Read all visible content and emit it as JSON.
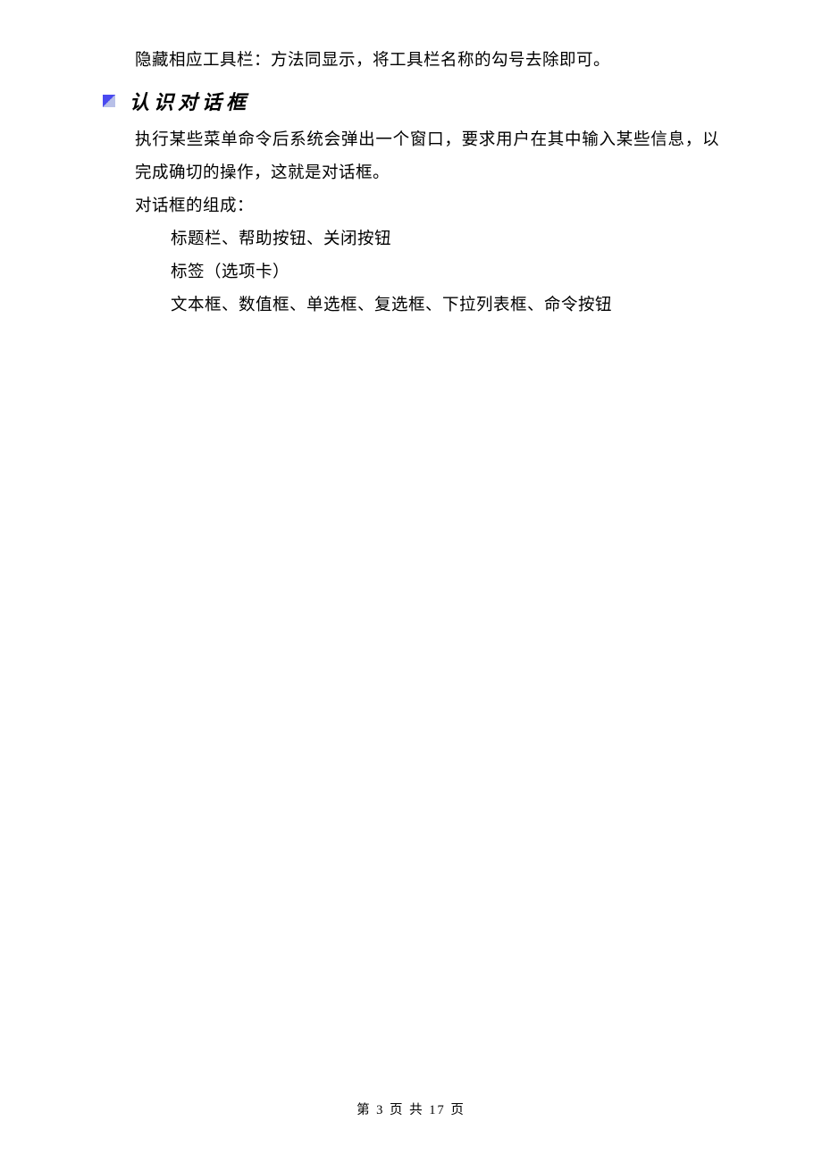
{
  "paragraphs": {
    "intro": "隐藏相应工具栏：方法同显示，将工具栏名称的勾号去除即可。",
    "heading": "认识对话框",
    "body1": "执行某些菜单命令后系统会弹出一个窗口，要求用户在其中输入某些信息，以完成确切的操作，这就是对话框。",
    "body2": "对话框的组成：",
    "list": [
      "标题栏、帮助按钮、关闭按钮",
      "标签（选项卡）",
      "文本框、数值框、单选框、复选框、下拉列表框、命令按钮"
    ]
  },
  "footer": "第 3 页 共 17 页"
}
